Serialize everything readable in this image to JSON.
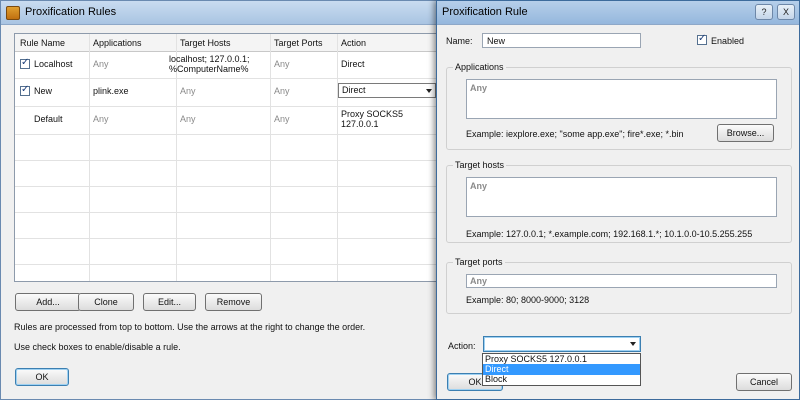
{
  "rules_window": {
    "title": "Proxification Rules",
    "columns": [
      "Rule Name",
      "Applications",
      "Target Hosts",
      "Target Ports",
      "Action"
    ],
    "rows": [
      {
        "checked": true,
        "name": "Localhost",
        "applications": "Any",
        "target_hosts_line1": "localhost; 127.0.0.1;",
        "target_hosts_line2": "%ComputerName%",
        "target_ports": "Any",
        "action": "Direct"
      },
      {
        "checked": true,
        "name": "New",
        "applications": "plink.exe",
        "target_hosts": "Any",
        "target_ports": "Any",
        "action": "Direct"
      },
      {
        "checked": false,
        "name": "Default",
        "applications": "Any",
        "target_hosts": "Any",
        "target_ports": "Any",
        "action_line1": "Proxy SOCKS5",
        "action_line2": "127.0.0.1"
      }
    ],
    "buttons": {
      "add": "Add...",
      "clone": "Clone",
      "edit": "Edit...",
      "remove": "Remove",
      "ok": "OK"
    },
    "info_line1": "Rules are processed from top to bottom. Use the arrows at the right to change the order.",
    "info_line2": "Use check boxes to enable/disable a rule."
  },
  "rule_window": {
    "title": "Proxification Rule",
    "title_buttons": {
      "help": "?",
      "close": "X"
    },
    "name_label": "Name:",
    "name_value": "New",
    "enabled_label": "Enabled",
    "enabled_checked": true,
    "applications": {
      "group_title": "Applications",
      "value": "Any",
      "example": "Example: iexplore.exe; \"some app.exe\"; fire*.exe; *.bin",
      "browse_label": "Browse..."
    },
    "target_hosts": {
      "group_title": "Target hosts",
      "value": "Any",
      "example": "Example: 127.0.0.1; *.example.com; 192.168.1.*; 10.1.0.0-10.5.255.255"
    },
    "target_ports": {
      "group_title": "Target ports",
      "value": "Any",
      "example": "Example: 80; 8000-9000; 3128"
    },
    "action_label": "Action:",
    "action_options": [
      "Proxy SOCKS5 127.0.0.1",
      "Direct",
      "Block"
    ],
    "action_highlighted": "Direct",
    "ok_label": "OK",
    "cancel_label": "Cancel"
  }
}
